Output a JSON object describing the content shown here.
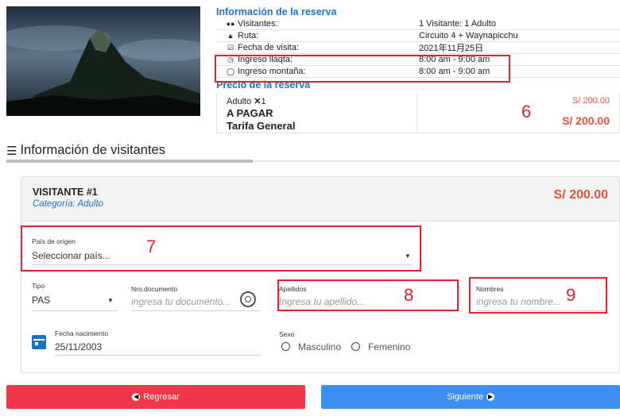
{
  "reserva": {
    "title": "Información de la reserva",
    "rows": [
      {
        "icon": "users-icon",
        "label": "Visitantes:",
        "value": "1 Visitante: 1 Adulto"
      },
      {
        "icon": "route-icon",
        "label": "Ruta:",
        "value": "Circuito 4 + Waynapicchu"
      },
      {
        "icon": "calendar-check-icon",
        "label": "Fecha de visita:",
        "value": "2021年11月25日"
      },
      {
        "icon": "clock-solid-icon",
        "label": "Ingreso llaqta:",
        "value": "8:00 am - 9:00 am"
      },
      {
        "icon": "clock-outline-icon",
        "label": "Ingreso montaña:",
        "value": "8:00 am - 9:00 am"
      }
    ]
  },
  "precio": {
    "title": "Precio de la reserva",
    "adult_label": "Adulto",
    "adult_qty": "1",
    "adult_price": "S/ 200.00",
    "pay_label": "A PAGAR",
    "tarifa_label": "Tarifa General",
    "total": "S/ 200.00"
  },
  "visitantes": {
    "title": "Información de visitantes",
    "card": {
      "title": "VISITANTE #1",
      "category": "Categoría: Adulto",
      "price": "S/ 200.00"
    },
    "pais": {
      "label": "País de origen",
      "value": "Seleccionar país..."
    },
    "tipo": {
      "label": "Tipo",
      "value": "PAS"
    },
    "documento": {
      "label": "Nro.documento",
      "placeholder": "ingresa tu documento..."
    },
    "apellidos": {
      "label": "Apellidos",
      "placeholder": "Ingresa tu apellido..."
    },
    "nombres": {
      "label": "Nombres",
      "placeholder": "ingresa tu nombre..."
    },
    "nacimiento": {
      "label": "Fecha nacimiento",
      "value": "25/11/2003"
    },
    "sexo": {
      "label": "Sexo",
      "options": [
        "Masculino",
        "Femenino"
      ]
    }
  },
  "annotations": [
    "6",
    "7",
    "8",
    "9"
  ],
  "buttons": {
    "back": "Regresar",
    "next": "Siguiente"
  },
  "colors": {
    "accent_blue": "#1a73c9",
    "price_red": "#e8503a",
    "highlight_red": "#e8202e",
    "back_button": "#f0384a",
    "next_button": "#3d8ef1"
  }
}
